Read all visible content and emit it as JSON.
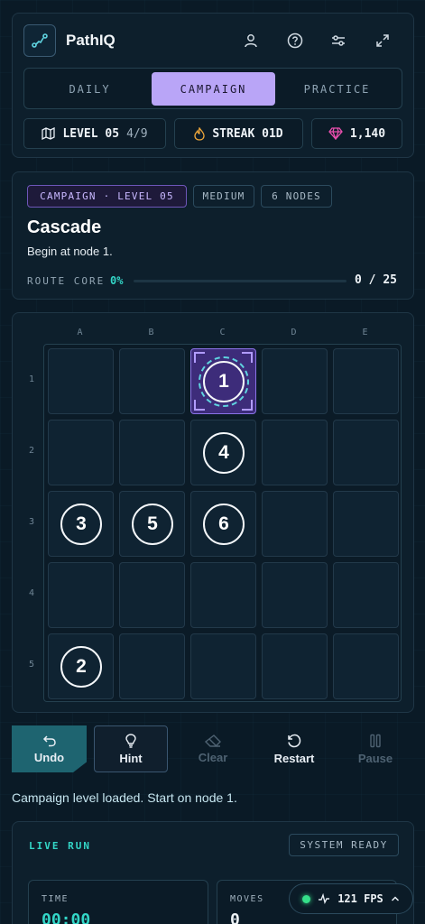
{
  "header": {
    "title": "PathIQ",
    "icons": [
      "user-icon",
      "help-icon",
      "sliders-icon",
      "expand-icon"
    ]
  },
  "tabs": [
    {
      "label": "DAILY",
      "active": false
    },
    {
      "label": "CAMPAIGN",
      "active": true
    },
    {
      "label": "PRACTICE",
      "active": false
    }
  ],
  "chips": {
    "level": "LEVEL 05",
    "level_progress": "4/9",
    "streak": "STREAK 01D",
    "gems": "1,140"
  },
  "level": {
    "tags": [
      "CAMPAIGN · LEVEL 05",
      "MEDIUM",
      "6 NODES"
    ],
    "name": "Cascade",
    "description": "Begin at node 1.",
    "route_label": "ROUTE CORE",
    "route_pct": "0%",
    "route_fraction": 0,
    "route_count": "0 / 25"
  },
  "board": {
    "columns": [
      "A",
      "B",
      "C",
      "D",
      "E"
    ],
    "rows": [
      "1",
      "2",
      "3",
      "4",
      "5"
    ],
    "nodes": [
      {
        "label": "1",
        "col": 2,
        "row": 0,
        "start": true
      },
      {
        "label": "4",
        "col": 2,
        "row": 1,
        "start": false
      },
      {
        "label": "3",
        "col": 0,
        "row": 2,
        "start": false
      },
      {
        "label": "5",
        "col": 1,
        "row": 2,
        "start": false
      },
      {
        "label": "6",
        "col": 2,
        "row": 2,
        "start": false
      },
      {
        "label": "2",
        "col": 0,
        "row": 4,
        "start": false
      }
    ]
  },
  "controls": {
    "undo": "Undo",
    "hint": "Hint",
    "clear": "Clear",
    "restart": "Restart",
    "pause": "Pause"
  },
  "status_message": "Campaign level loaded. Start on node 1.",
  "live": {
    "label": "LIVE RUN",
    "status": "SYSTEM READY",
    "time_label": "TIME",
    "time_value": "00:00",
    "moves_label": "MOVES",
    "moves_value": "0"
  },
  "fps": "121 FPS",
  "colors": {
    "accent": "#b9a5f7",
    "teal": "#33d6c7",
    "bg": "#0a1a26"
  }
}
